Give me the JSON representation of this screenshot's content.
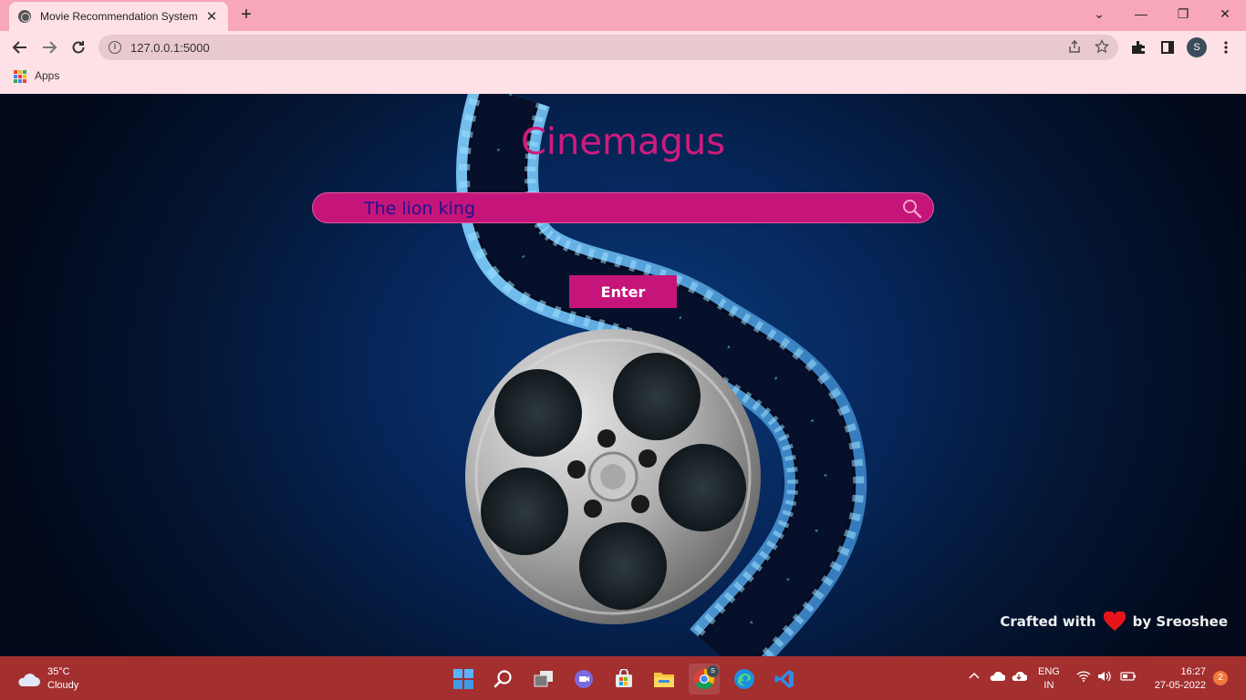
{
  "browser": {
    "tab_title": "Movie Recommendation System",
    "tab_close": "✕",
    "new_tab": "+",
    "url": "127.0.0.1:5000",
    "bookmarks": {
      "apps_label": "Apps"
    },
    "profile_initial": "S",
    "window_controls": {
      "menu": "⌄",
      "minimize": "—",
      "restore": "❐",
      "close": "✕"
    }
  },
  "page": {
    "title": "Cinemagus",
    "search": {
      "value": "The lion king",
      "placeholder": ""
    },
    "enter_label": "Enter",
    "footer": {
      "prefix": "Crafted with",
      "suffix": "by Sreoshee"
    },
    "colors": {
      "accent": "#c5157a",
      "title": "#cf1b7d",
      "search_text": "#1a1590",
      "background": "#06265a"
    }
  },
  "taskbar": {
    "weather": {
      "temp": "35°C",
      "condition": "Cloudy"
    },
    "lang": {
      "line1": "ENG",
      "line2": "IN"
    },
    "clock": {
      "time": "16:27",
      "date": "27-05-2022"
    },
    "notification_count": "2",
    "chrome_badge": "S",
    "apps": [
      "start-icon",
      "search-icon",
      "task-view-icon",
      "teams-icon",
      "store-icon",
      "file-explorer-icon",
      "chrome-icon",
      "edge-icon",
      "vscode-icon"
    ]
  }
}
